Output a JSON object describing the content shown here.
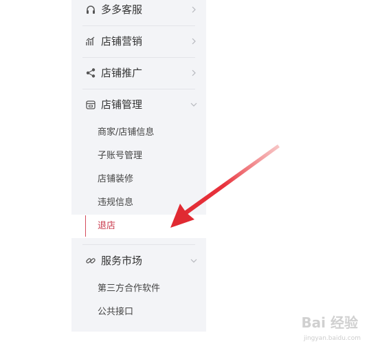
{
  "sidebar": {
    "sections": [
      {
        "label": "多多客服",
        "icon": "headset-icon",
        "expanded": false
      },
      {
        "label": "店铺营销",
        "icon": "bar-chart-icon",
        "expanded": false
      },
      {
        "label": "店铺推广",
        "icon": "share-icon",
        "expanded": false
      },
      {
        "label": "店铺管理",
        "icon": "store-icon",
        "expanded": true,
        "items": [
          "商家/店铺信息",
          "子账号管理",
          "店铺装修",
          "违规信息",
          "退店"
        ],
        "active_item": "退店"
      },
      {
        "label": "服务市场",
        "icon": "link-icon",
        "expanded": true,
        "items": [
          "第三方合作软件",
          "公共接口"
        ]
      }
    ]
  },
  "colors": {
    "sidebar_bg": "#f3f4f7",
    "active_accent": "#d44a5a",
    "annotation_arrow": "#e8323c"
  },
  "watermark": {
    "logo": "Bai 经验",
    "url": "jingyan.baidu.com"
  }
}
